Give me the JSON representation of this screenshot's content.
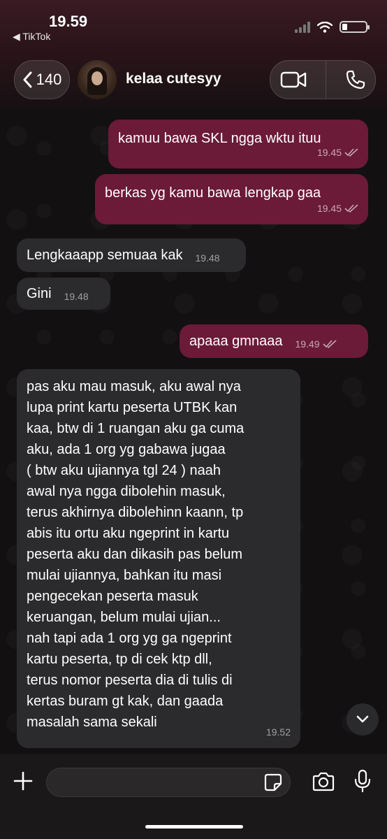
{
  "status_bar": {
    "time": "19.59",
    "back_app": "◀ TikTok"
  },
  "header": {
    "back_count": "140",
    "contact_name": "kelaa cutesyy"
  },
  "colors": {
    "outgoing": "#6b1a38",
    "incoming": "#2b2a2c",
    "background": "#121011"
  },
  "messages": [
    {
      "dir": "out",
      "text": "kamuu bawa SKL ngga wktu ituu",
      "time": "19.45",
      "read": true
    },
    {
      "dir": "out",
      "text": "berkas yg kamu bawa lengkap gaa",
      "time": "19.45",
      "read": true
    },
    {
      "dir": "in",
      "text": "Lengkaaapp semuaa kak",
      "time": "19.48"
    },
    {
      "dir": "in",
      "text": "Gini",
      "time": "19.48"
    },
    {
      "dir": "out",
      "text": "apaaa gmnaaa",
      "time": "19.49",
      "read": true
    },
    {
      "dir": "in",
      "text": "pas aku mau masuk, aku awal nya\nlupa print kartu peserta UTBK kan\nkaa, btw di 1 ruangan aku ga cuma\naku, ada 1 org yg gabawa jugaa\n( btw aku ujiannya tgl 24 ) naah\nawal nya ngga dibolehin masuk,\nterus akhirnya dibolehinn kaann, tp\nabis itu ortu aku ngeprint in kartu\npeserta aku dan dikasih pas belum\nmulai ujiannya, bahkan itu masi\npengecekan peserta masuk\nkeruangan, belum mulai ujian...\nnah tapi ada 1 org yg ga ngeprint\nkartu peserta, tp di cek ktp dll,\nterus nomor peserta dia di tulis di\nkertas buram gt kak, dan gaada\nmasalah sama sekali",
      "time": "19.52"
    }
  ],
  "icons": {
    "back": "chevron-left-icon",
    "video": "video-icon",
    "call": "phone-icon",
    "plus": "plus-icon",
    "sticker": "sticker-icon",
    "camera": "camera-icon",
    "mic": "microphone-icon",
    "scroll": "chevron-down-icon"
  }
}
